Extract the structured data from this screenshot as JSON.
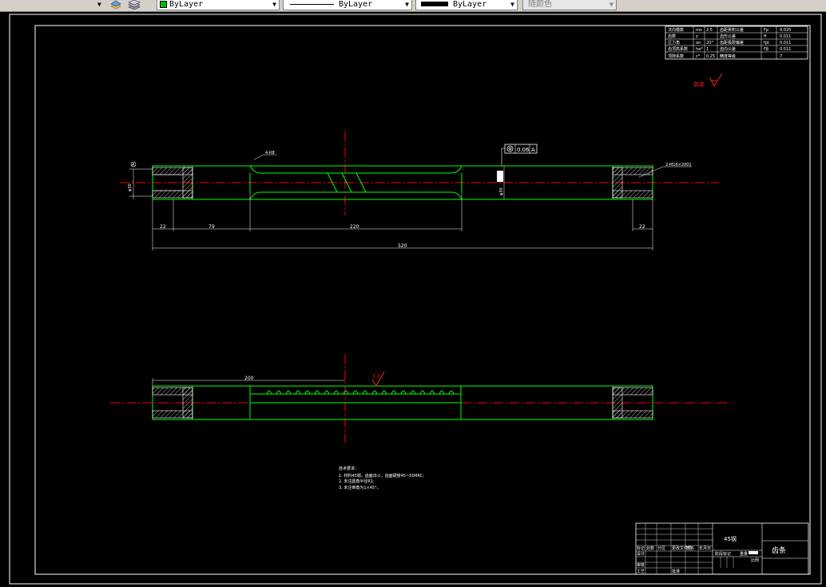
{
  "toolbar": {
    "layer_color_value": "ByLayer",
    "linetype_value": "ByLayer",
    "lineweight_value": "ByLayer",
    "plot_style_value": "随颜色",
    "colors": {
      "layer_swatch": "#00c000"
    }
  },
  "drawing": {
    "colors": {
      "outline": "#00ff00",
      "center": "#ff0000",
      "text": "#ffffff",
      "hatch": "#ffffff"
    },
    "top_view": {
      "datum_label": "A",
      "dia_left": "φ30",
      "dia_right": "φ30",
      "keyway_note": "4-R8",
      "thread_note": "2-M16×2001",
      "tolerance_value": "0.06",
      "tolerance_datum": "A",
      "dims": {
        "d1": "22",
        "d2": "79",
        "d3": "220",
        "d4": "22",
        "overall": "520"
      }
    },
    "bottom_view": {
      "dim_length": "200",
      "roughness": "3.2"
    },
    "roughness_note": "其余",
    "tech_req": {
      "title": "技术要求：",
      "items": [
        "1. 材料45钢，齿面淬火，齿面硬度45~50HRC;",
        "2. 未注圆角半径R1;",
        "3. 未注倒角为1×45°。"
      ]
    },
    "param_table": {
      "rows": [
        {
          "c1": "法向模数",
          "c2": "mn",
          "c3": "2.5",
          "c4": "齿距累积公差",
          "c5": "Fp",
          "c6": "0.025"
        },
        {
          "c1": "齿数",
          "c2": "z",
          "c3": "",
          "c4": "齿形公差",
          "c5": "ff",
          "c6": "0.011"
        },
        {
          "c1": "压力角",
          "c2": "αn",
          "c3": "20°",
          "c4": "齿距极限偏差",
          "c5": "fpt",
          "c6": "0.011"
        },
        {
          "c1": "齿顶高系数",
          "c2": "ha*",
          "c3": "1",
          "c4": "齿向公差",
          "c5": "Fβ",
          "c6": "0.011"
        },
        {
          "c1": "顶隙系数",
          "c2": "c*",
          "c3": "0.25",
          "c4": "精度等级",
          "c5": "",
          "c6": "7"
        }
      ]
    },
    "title_block": {
      "part_name": "齿条",
      "row_labels": [
        "标记",
        "处数",
        "分区",
        "更改文件号",
        "签名",
        "年月日"
      ],
      "people": [
        "设计",
        "审核",
        "工艺",
        "批准"
      ],
      "stage_label": "阶段标记",
      "weight_label": "重量",
      "scale_label": "比例",
      "material": "45钢"
    }
  }
}
